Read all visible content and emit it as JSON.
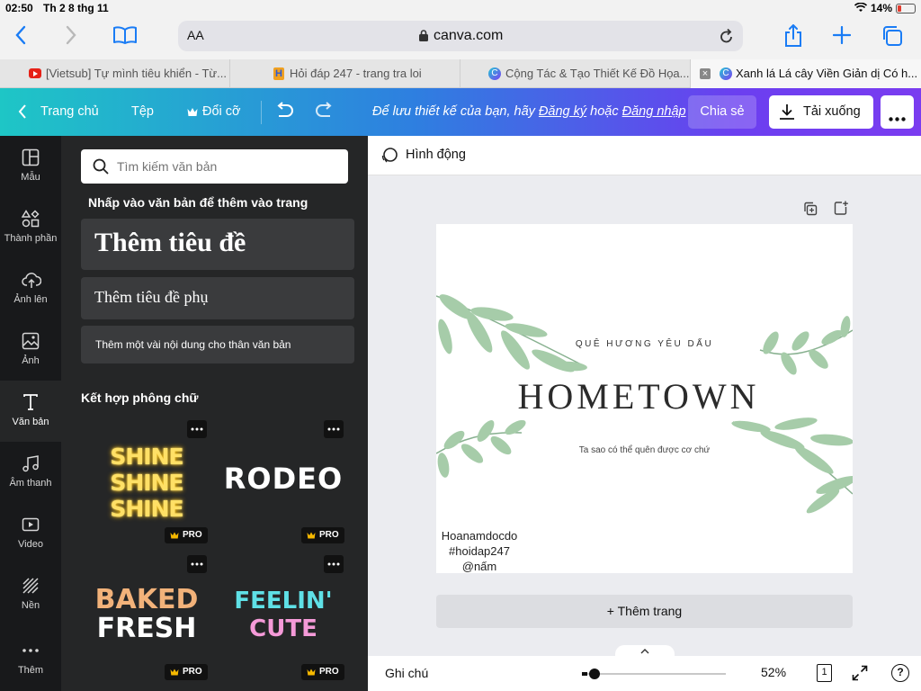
{
  "status": {
    "time": "02:50",
    "date": "Th 2 8 thg 11",
    "battery": "14%"
  },
  "safari": {
    "text_size": "AA",
    "url": "canva.com"
  },
  "tabs": [
    {
      "title": "[Vietsub] Tự mình tiêu khiển - Từ..."
    },
    {
      "title": "Hỏi đáp 247 - trang tra loi"
    },
    {
      "title": "Cộng Tác & Tạo Thiết Kế Đồ Họa..."
    },
    {
      "title": "Xanh lá Lá cây Viền Giản dị Có h..."
    }
  ],
  "header": {
    "home": "Trang chủ",
    "file": "Tệp",
    "resize": "Đổi cỡ",
    "save_prompt": "Để lưu thiết kế của bạn, hãy",
    "signup": "Đăng ký",
    "or": "hoặc",
    "login": "Đăng nhập",
    "share": "Chia sẻ",
    "download": "Tải xuống"
  },
  "rail": [
    {
      "label": "Mẫu",
      "icon": "template-icon"
    },
    {
      "label": "Thành phần",
      "icon": "elements-icon"
    },
    {
      "label": "Ảnh lên",
      "icon": "upload-icon"
    },
    {
      "label": "Ảnh",
      "icon": "photo-icon"
    },
    {
      "label": "Văn bản",
      "icon": "text-icon"
    },
    {
      "label": "Âm thanh",
      "icon": "music-icon"
    },
    {
      "label": "Video",
      "icon": "video-icon"
    },
    {
      "label": "Nền",
      "icon": "background-icon"
    },
    {
      "label": "Thêm",
      "icon": "more-icon"
    }
  ],
  "panel": {
    "search_placeholder": "Tìm kiếm văn bản",
    "hint": "Nhấp vào văn bản để thêm vào trang",
    "add_heading": "Thêm tiêu đề",
    "add_subheading": "Thêm tiêu đề phụ",
    "add_body": "Thêm một vài nội dung cho thân văn bản",
    "combos_title": "Kết hợp phông chữ",
    "pro_label": "PRO",
    "combos": [
      {
        "line1": "SHINE",
        "line2": "SHINE",
        "line3": "SHINE"
      },
      {
        "line1": "RODEO"
      },
      {
        "line1": "BAKED",
        "line2": "FRESH"
      },
      {
        "line1": "FEELIN'",
        "line2": "CUTE"
      }
    ]
  },
  "workspace": {
    "animate": "Hình động",
    "add_page": "+ Thêm trang",
    "notes": "Ghi chú",
    "zoom": "52%",
    "page_count": "1",
    "help": "?"
  },
  "design": {
    "kicker": "QUÊ HƯƠNG YÊU DẤU",
    "title": "HOMETOWN",
    "subtitle": "Ta sao có thể quên được cơ chứ",
    "author": "Hoanamdocdo",
    "hashtag": "#hoidap247",
    "handle": "@nấm"
  }
}
